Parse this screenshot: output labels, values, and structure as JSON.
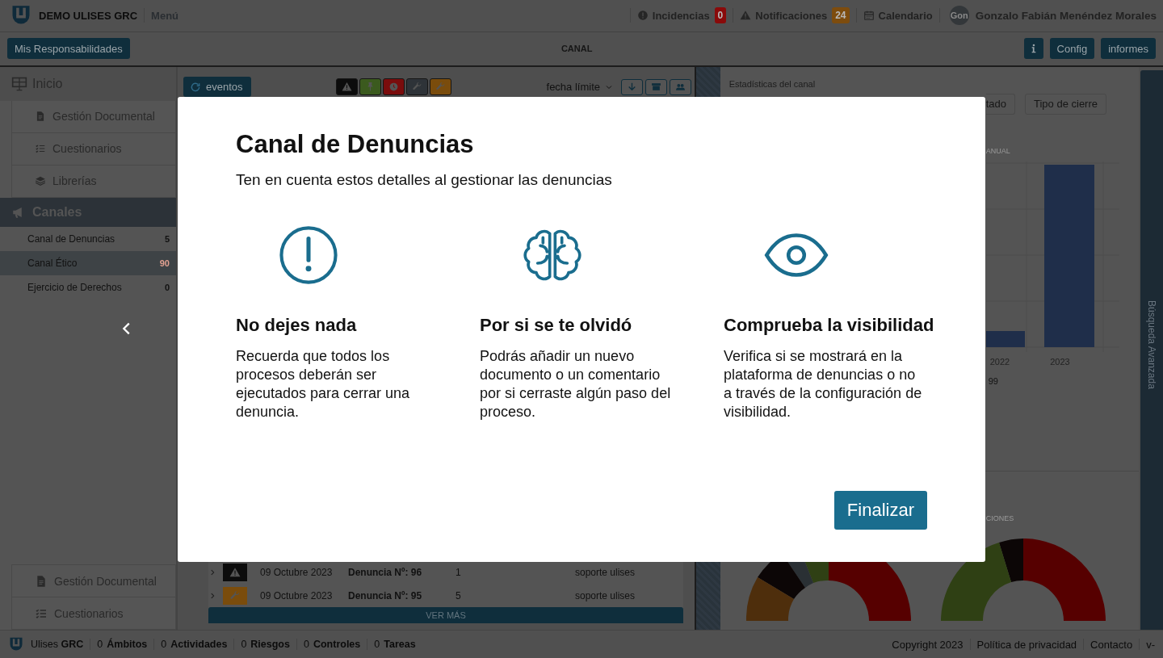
{
  "header": {
    "brand": "DEMO ULISES GRC",
    "menu": "Menú",
    "links": [
      {
        "kind": "alert",
        "label": "Incidencias",
        "badge": "0",
        "color": "#8a0a0a"
      },
      {
        "kind": "warning",
        "label": "Notificaciones",
        "badge": "24",
        "color": "#7d4c0e"
      },
      {
        "kind": "calendar",
        "label": "Calendario"
      }
    ],
    "user": {
      "avatar_text": "Gon",
      "name": "Gonzalo Fabián Menéndez Morales"
    }
  },
  "toolbar": {
    "primary_button": "Mis Responsabilidades",
    "title": "CANAL",
    "buttons": [
      {
        "kind": "info"
      },
      {
        "kind": "text",
        "label": "Config"
      },
      {
        "kind": "text",
        "label": "informes"
      }
    ]
  },
  "sidebar": {
    "home": "Inicio",
    "top_items": [
      {
        "kind": "document",
        "label": "Gestión Documental"
      },
      {
        "kind": "checklist",
        "label": "Cuestionarios"
      },
      {
        "kind": "layers",
        "label": "Librerías"
      }
    ],
    "section": "Canales",
    "channels": [
      {
        "label": "Canal de Denuncias",
        "count": "5",
        "selected": false
      },
      {
        "label": "Canal Ético",
        "count": "90",
        "selected": true
      },
      {
        "label": "Ejercicio de Derechos",
        "count": "0",
        "selected": false
      }
    ],
    "bottom_items": [
      {
        "kind": "document",
        "label": "Gestión Documental"
      },
      {
        "kind": "checklist",
        "label": "Cuestionarios"
      }
    ]
  },
  "events": {
    "refresh_button": "eventos",
    "filters": [
      {
        "kind": "warning",
        "color": "#0c0c0c"
      },
      {
        "kind": "pin",
        "color": "#3b5a1e"
      },
      {
        "kind": "clock",
        "color": "#7a0c0c"
      },
      {
        "kind": "wrench",
        "color": "#2e3338"
      },
      {
        "kind": "wrench",
        "color": "#7a4c0c"
      }
    ],
    "sort": "fecha límite",
    "actions": [
      {
        "kind": "down"
      },
      {
        "kind": "archive"
      },
      {
        "kind": "group"
      }
    ],
    "rows": [
      {
        "kind": "warning",
        "color": "#0c0c0c",
        "date": "09 Octubre 2023",
        "title": "Denuncia Nº: 96",
        "count": "1",
        "user": "soporte ulises"
      },
      {
        "kind": "wrench",
        "color": "#7a4c0c",
        "date": "09 Octubre 2023",
        "title": "Denuncia Nº: 95",
        "count": "5",
        "user": "soporte ulises"
      }
    ],
    "more_button": "VER MÁS"
  },
  "stats": {
    "title": "Estadísticas del canal",
    "tabs": [
      {
        "label": "tado",
        "selected": false
      },
      {
        "label": "Tipo de cierre",
        "selected": false
      }
    ],
    "chart_caption": "ANUAL",
    "axis_labels": [
      "2022",
      "2023"
    ],
    "total": "99",
    "donut_caption": "CIONES"
  },
  "side_tab": "Búsqueda Avanzada",
  "footer": {
    "brand": "Ulises **GRC**",
    "counts": [
      {
        "count": "0",
        "label": "Ámbitos"
      },
      {
        "count": "0",
        "label": "Actividades"
      },
      {
        "count": "0",
        "label": "Riesgos"
      },
      {
        "count": "0",
        "label": "Controles"
      },
      {
        "count": "0",
        "label": "Tareas"
      }
    ],
    "links": [
      "Copyright 2023",
      "Política de privacidad",
      "Contacto",
      "v-"
    ]
  },
  "modal": {
    "title": "Canal de Denuncias",
    "subtitle": "Ten en cuenta estos detalles al gestionar las denuncias",
    "tips": [
      {
        "kind": "alert",
        "title": "No dejes nada",
        "text": "Recuerda que todos los procesos deberán ser ejecutados para cerrar una denuncia."
      },
      {
        "kind": "brain",
        "title": "Por si se te olvidó",
        "text": "Podrás añadir un nuevo documento o un comentario por si cerraste algún paso del proceso."
      },
      {
        "kind": "eye",
        "title": "Comprueba la visibilidad",
        "text": "Verifica si se mostrará en la plataforma de denuncias o no a través de la configuración de visibilidad."
      }
    ],
    "button": "Finalizar"
  }
}
